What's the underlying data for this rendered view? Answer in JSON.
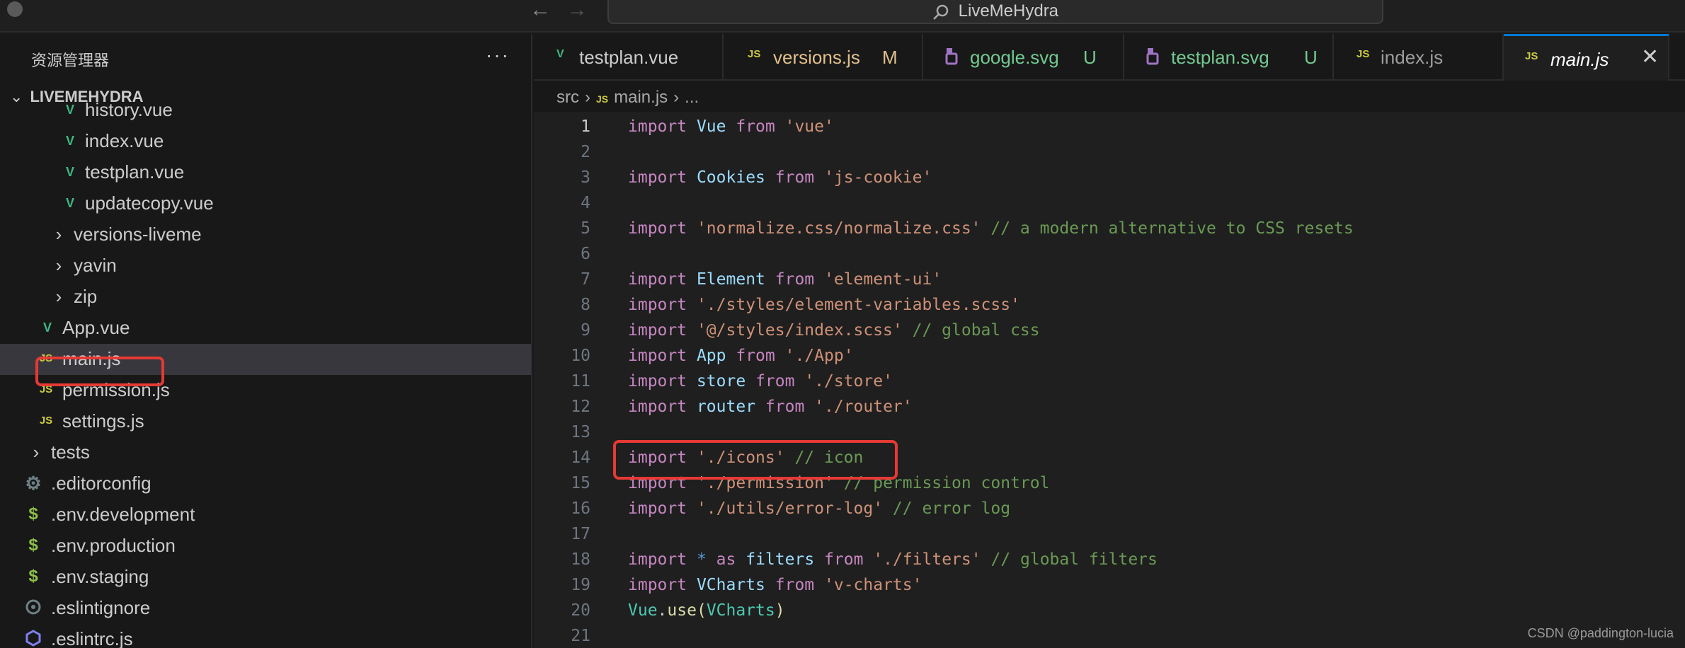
{
  "window": {
    "title": "LiveMeHydra"
  },
  "sidebar": {
    "header": "资源管理器",
    "more": "···",
    "root": "LIVEMEHYDRA",
    "items": [
      {
        "label": "history.vue",
        "icon": "vue-icon"
      },
      {
        "label": "index.vue",
        "icon": "vue-icon"
      },
      {
        "label": "testplan.vue",
        "icon": "vue-icon"
      },
      {
        "label": "updatecopy.vue",
        "icon": "vue-icon"
      },
      {
        "label": "versions-liveme",
        "icon": "chevron-right-icon"
      },
      {
        "label": "yavin",
        "icon": "chevron-right-icon"
      },
      {
        "label": "zip",
        "icon": "chevron-right-icon"
      },
      {
        "label": "App.vue",
        "icon": "vue-icon"
      },
      {
        "label": "main.js",
        "icon": "js-icon"
      },
      {
        "label": "permission.js",
        "icon": "js-icon"
      },
      {
        "label": "settings.js",
        "icon": "js-icon"
      },
      {
        "label": "tests",
        "icon": "chevron-right-icon"
      },
      {
        "label": ".editorconfig",
        "icon": "gear-icon"
      },
      {
        "label": ".env.development",
        "icon": "dollar-icon"
      },
      {
        "label": ".env.production",
        "icon": "dollar-icon"
      },
      {
        "label": ".env.staging",
        "icon": "dollar-icon"
      },
      {
        "label": ".eslintignore",
        "icon": "eslint-icon"
      },
      {
        "label": ".eslintrc.js",
        "icon": "eslint-icon"
      }
    ]
  },
  "tabs": [
    {
      "label": "testplan.vue",
      "badge": ""
    },
    {
      "label": "versions.js",
      "badge": "M"
    },
    {
      "label": "google.svg",
      "badge": "U"
    },
    {
      "label": "testplan.svg",
      "badge": "U"
    },
    {
      "label": "index.js",
      "badge": ""
    },
    {
      "label": "main.js",
      "badge": ""
    }
  ],
  "breadcrumb": {
    "folder": "src",
    "js_badge": "JS",
    "file": "main.js",
    "more": "..."
  },
  "js_badge": "JS",
  "vue_badge": "V",
  "close": "✕",
  "editor": {
    "lines": [
      "1",
      "2",
      "3",
      "4",
      "5",
      "6",
      "7",
      "8",
      "9",
      "10",
      "11",
      "12",
      "13",
      "14",
      "15",
      "16",
      "17",
      "18",
      "19",
      "20",
      "21"
    ],
    "code": {
      "l1": {
        "kw": "import",
        "id": "Vue",
        "from": "from",
        "str": "'vue'"
      },
      "l3": {
        "kw": "import",
        "id": "Cookies",
        "from": "from",
        "str": "'js-cookie'"
      },
      "l5": {
        "kw": "import",
        "str": "'normalize.css/normalize.css'",
        "cm": "// a modern alternative to CSS resets"
      },
      "l7": {
        "kw": "import",
        "id": "Element",
        "from": "from",
        "str": "'element-ui'"
      },
      "l8": {
        "kw": "import",
        "str": "'./styles/element-variables.scss'"
      },
      "l9": {
        "kw": "import",
        "str": "'@/styles/index.scss'",
        "cm": "// global css"
      },
      "l10": {
        "kw": "import",
        "id": "App",
        "from": "from",
        "str": "'./App'"
      },
      "l11": {
        "kw": "import",
        "id": "store",
        "from": "from",
        "str": "'./store'"
      },
      "l12": {
        "kw": "import",
        "id": "router",
        "from": "from",
        "str": "'./router'"
      },
      "l14": {
        "kw": "import",
        "str": "'./icons'",
        "cm": "// icon"
      },
      "l15": {
        "kw": "import",
        "str": "'./permission'",
        "cm": "// permission control"
      },
      "l16": {
        "kw": "import",
        "str": "'./utils/error-log'",
        "cm": "// error log"
      },
      "l18": {
        "kw": "import",
        "star": "*",
        "as": "as",
        "id": "filters",
        "from": "from",
        "str": "'./filters'",
        "cm": "// global filters"
      },
      "l19": {
        "kw": "import",
        "id": "VCharts",
        "from": "from",
        "str": "'v-charts'"
      },
      "l20": {
        "obj": "Vue",
        "dot": ".",
        "fn": "use",
        "open": "(",
        "arg": "VCharts",
        "close": ")"
      }
    }
  },
  "watermark": "CSDN @paddington-lucia",
  "colors": {
    "accent": "#0078d4",
    "highlight_box": "#e53935",
    "vue": "#41b883",
    "js": "#cbcb41"
  }
}
